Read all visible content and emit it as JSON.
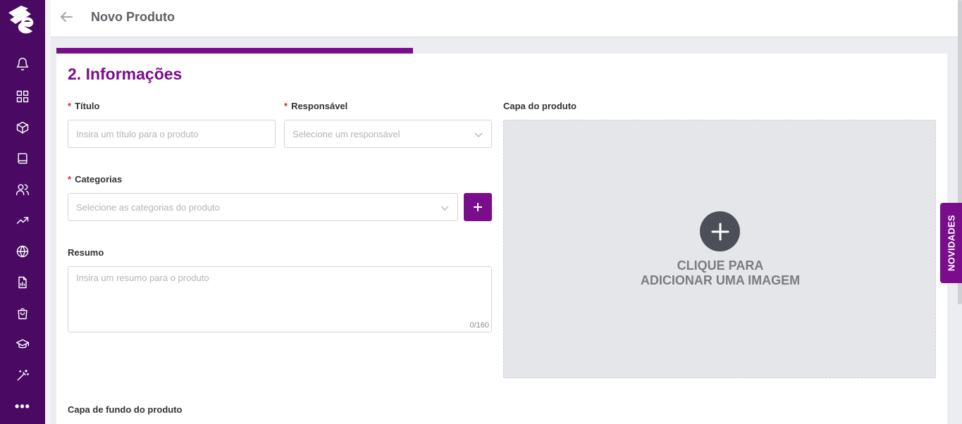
{
  "header": {
    "title": "Novo Produto"
  },
  "sidebar": {
    "more_label": "•••",
    "items": [
      {
        "icon": "bell-icon"
      },
      {
        "icon": "grid-icon"
      },
      {
        "icon": "box-icon"
      },
      {
        "icon": "book-icon"
      },
      {
        "icon": "users-icon"
      },
      {
        "icon": "trending-up-icon"
      },
      {
        "icon": "globe-icon"
      },
      {
        "icon": "report-icon"
      },
      {
        "icon": "shopping-bag-icon"
      },
      {
        "icon": "graduation-cap-icon"
      },
      {
        "icon": "magic-wand-icon"
      },
      {
        "icon": "more-icon"
      }
    ]
  },
  "progress": {
    "percent": 40
  },
  "form": {
    "step_title": "2. Informações",
    "required_mark": "*",
    "titulo": {
      "label": "Título",
      "placeholder": "Insira um título para o produto"
    },
    "responsavel": {
      "label": "Responsável",
      "placeholder": "Selecione um responsável"
    },
    "categorias": {
      "label": "Categorias",
      "placeholder": "Selecione as categorias do produto"
    },
    "resumo": {
      "label": "Resumo",
      "placeholder": "Insira um resumo para o produto",
      "counter": "0/160"
    },
    "capa": {
      "label": "Capa do produto",
      "line1": "CLIQUE PARA",
      "line2": "ADICIONAR UMA IMAGEM"
    },
    "capa_fundo": {
      "label": "Capa de fundo do produto"
    }
  },
  "novidades": {
    "label": "NOVIDADES"
  },
  "colors": {
    "brand": "#7a0d8c",
    "sidebar": "#4a0a63"
  }
}
